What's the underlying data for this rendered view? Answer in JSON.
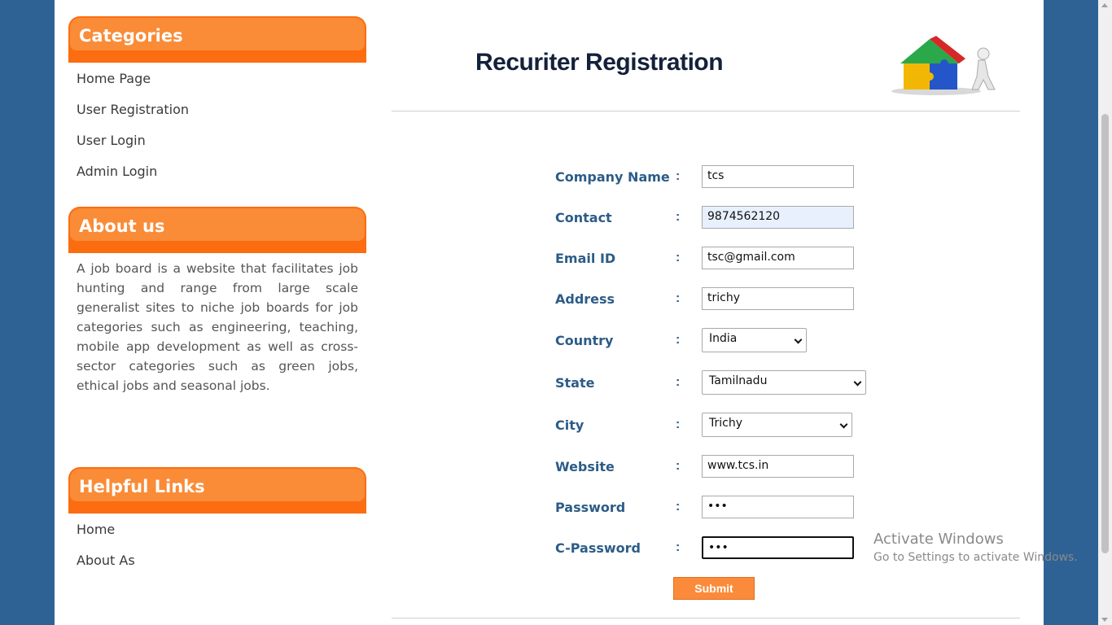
{
  "sidebar": {
    "categories": {
      "title": "Categories",
      "items": [
        "Home Page",
        "User Registration",
        "User Login",
        "Admin Login"
      ]
    },
    "about": {
      "title": "About us",
      "text": "A job board is a website that facilitates job hunting and range from large scale generalist sites to niche job boards for job categories such as engineering, teaching, mobile app development as well as cross-sector categories such as green jobs, ethical jobs and seasonal jobs."
    },
    "helpful": {
      "title": "Helpful Links",
      "items": [
        "Home",
        "About As"
      ]
    }
  },
  "main": {
    "title": "Recuriter Registration",
    "colon": ":",
    "form": {
      "company_label": "Company Name",
      "company_value": "tcs",
      "contact_label": "Contact",
      "contact_value": "9874562120",
      "email_label": "Email ID",
      "email_value": "tsc@gmail.com",
      "address_label": "Address",
      "address_value": "trichy",
      "country_label": "Country",
      "country_value": "India",
      "state_label": "State",
      "state_value": "Tamilnadu",
      "city_label": "City",
      "city_value": "Trichy",
      "website_label": "Website",
      "website_value": "www.tcs.in",
      "password_label": "Password",
      "password_value": "•••",
      "cpassword_label": "C-Password",
      "cpassword_value": "•••",
      "submit_label": "Submit"
    }
  },
  "watermark": {
    "line1": "Activate Windows",
    "line2": "Go to Settings to activate Windows."
  },
  "colors": {
    "background": "#2e6295",
    "accent_orange": "#fb6d10",
    "label_blue": "#2c5c88"
  },
  "icons": [
    "puzzle-house-logo-icon",
    "chevron-down-icon"
  ]
}
